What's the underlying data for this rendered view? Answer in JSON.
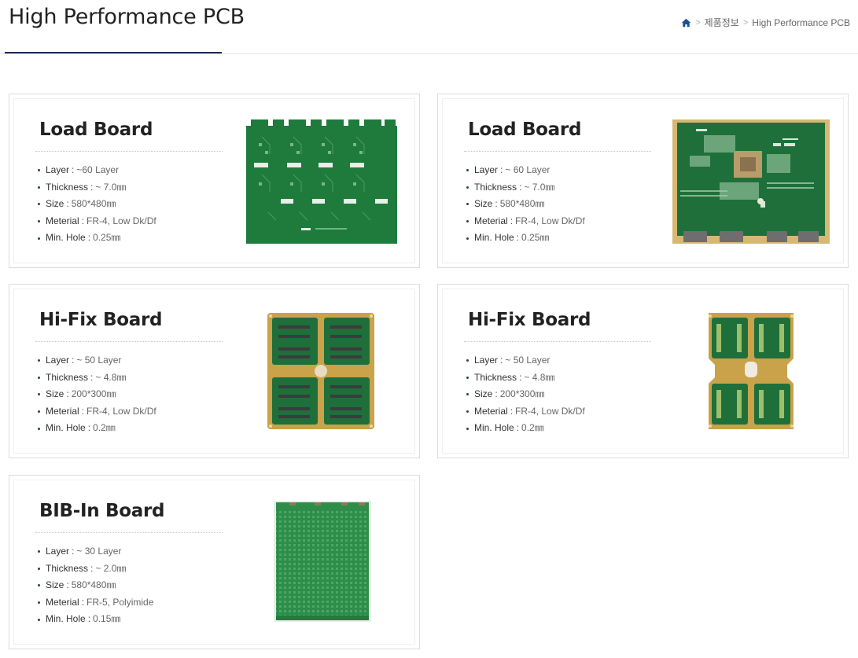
{
  "page": {
    "title": "High Performance PCB"
  },
  "breadcrumb": {
    "home_icon": "home-icon",
    "items": [
      "제품정보",
      "High Performance PCB"
    ],
    "separator": ">"
  },
  "colors": {
    "accent": "#1d2a55",
    "pcb_green": "#1f7a3a",
    "gold": "#c9a24a"
  },
  "products": [
    {
      "title": "Load Board",
      "specs": [
        {
          "label": "Layer",
          "value": "~60 Layer"
        },
        {
          "label": "Thickness",
          "value": "~ 7.0㎜"
        },
        {
          "label": "Size",
          "value": "580*480㎜"
        },
        {
          "label": "Meterial",
          "value": "FR-4, Low Dk/Df"
        },
        {
          "label": "Min. Hole",
          "value": "0.25㎜"
        }
      ],
      "image": "load-board-pcb-image"
    },
    {
      "title": "Load Board",
      "specs": [
        {
          "label": "Layer",
          "value": "~ 60 Layer"
        },
        {
          "label": "Thickness",
          "value": "~ 7.0㎜"
        },
        {
          "label": "Size",
          "value": "580*480㎜"
        },
        {
          "label": "Meterial",
          "value": "FR-4, Low Dk/Df"
        },
        {
          "label": "Min. Hole",
          "value": "0.25㎜"
        }
      ],
      "image": "load-board-pcb-image"
    },
    {
      "title": "Hi-Fix Board",
      "specs": [
        {
          "label": "Layer",
          "value": "~ 50 Layer"
        },
        {
          "label": "Thickness",
          "value": "~ 4.8㎜"
        },
        {
          "label": "Size",
          "value": "200*300㎜"
        },
        {
          "label": "Meterial",
          "value": "FR-4, Low Dk/Df"
        },
        {
          "label": "Min. Hole",
          "value": "0.2㎜"
        }
      ],
      "image": "hi-fix-board-pcb-image"
    },
    {
      "title": "Hi-Fix Board",
      "specs": [
        {
          "label": "Layer",
          "value": "~ 50 Layer"
        },
        {
          "label": "Thickness",
          "value": "~ 4.8㎜"
        },
        {
          "label": "Size",
          "value": "200*300㎜"
        },
        {
          "label": "Meterial",
          "value": "FR-4, Low Dk/Df"
        },
        {
          "label": "Min. Hole",
          "value": "0.2㎜"
        }
      ],
      "image": "hi-fix-board-pcb-image"
    },
    {
      "title": "BIB-In Board",
      "specs": [
        {
          "label": "Layer",
          "value": "~ 30 Layer"
        },
        {
          "label": "Thickness",
          "value": "~ 2.0㎜"
        },
        {
          "label": "Size",
          "value": "580*480㎜"
        },
        {
          "label": "Meterial",
          "value": "FR-5, Polyimide"
        },
        {
          "label": "Min. Hole",
          "value": "0.15㎜"
        }
      ],
      "image": "bib-in-board-pcb-image"
    }
  ]
}
